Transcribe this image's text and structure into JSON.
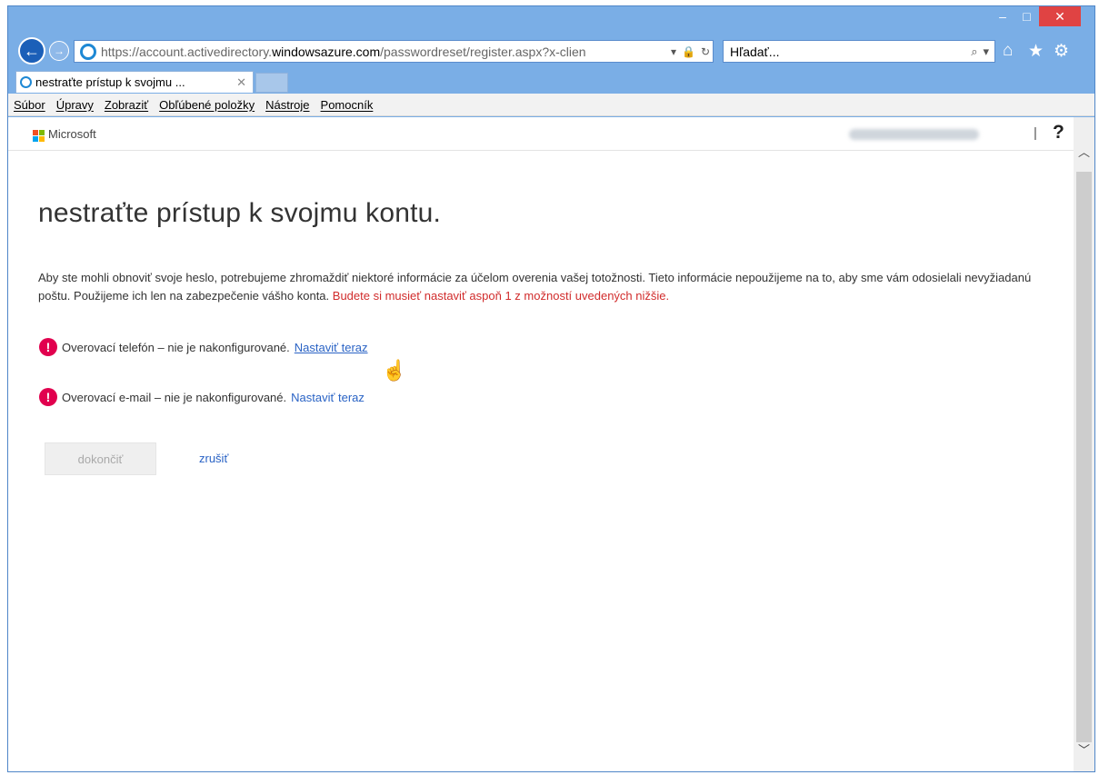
{
  "browser": {
    "window_controls": {
      "minimize": "–",
      "maximize": "□",
      "close": "✕"
    },
    "address": {
      "url_prefix": "https://account.activedirectory.",
      "url_domain": "windowsazure.com",
      "url_suffix": "/passwordreset/register.aspx?x-clien",
      "dropdown": "▾",
      "lock": "🔒",
      "refresh": "↻"
    },
    "search": {
      "placeholder": "Hľadať...",
      "icon": "⌕",
      "dropdown": "▾"
    },
    "tab": {
      "title": "nestraťte prístup k svojmu ...",
      "close": "✕"
    },
    "toolbar_icons": {
      "home": "⌂",
      "favorites": "★",
      "tools": "⚙"
    },
    "menu": [
      "Súbor",
      "Úpravy",
      "Zobraziť",
      "Obľúbené položky",
      "Nástroje",
      "Pomocník"
    ]
  },
  "header": {
    "brand": "Microsoft",
    "separator": "|",
    "help": "?"
  },
  "main": {
    "title": "nestraťte prístup k svojmu kontu.",
    "description": "Aby ste mohli obnoviť svoje heslo, potrebujeme zhromaždiť niektoré informácie za účelom overenia vašej totožnosti. Tieto informácie nepoužijeme na to, aby sme vám odosielali nevyžiadanú poštu. Použijeme ich len na zabezpečenie vášho konta.",
    "warning": "Budete si musieť nastaviť aspoň 1 z možností uvedených nižšie.",
    "items": [
      {
        "icon": "!",
        "text": "Overovací telefón – nie je nakonfigurované.",
        "link": "Nastaviť teraz"
      },
      {
        "icon": "!",
        "text": "Overovací e-mail – nie je nakonfigurované.",
        "link": "Nastaviť teraz"
      }
    ],
    "finish_button": "dokončiť",
    "cancel_link": "zrušiť"
  },
  "colors": {
    "ie_frame": "#7aaee6",
    "link": "#2a63c5",
    "warning": "#d12c2c",
    "alert_icon": "#e1004e",
    "ms_logo": [
      "#f25022",
      "#7fba00",
      "#00a4ef",
      "#ffb900"
    ]
  }
}
